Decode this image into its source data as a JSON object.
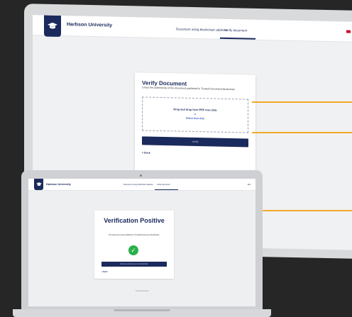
{
  "desktop": {
    "brand": "Harbson University",
    "nav": {
      "blockchain_link": "Document using blockchain address",
      "verify_link": "Verify document"
    },
    "card": {
      "title": "Verify Document",
      "subtitle": "Check the authenticity of the document published in Trusted Document blockchain.",
      "drop_text": "Drag and drop here PDF max 2mb",
      "drop_or": "or",
      "drop_link": "Select from disk",
      "verify_button": "Verify",
      "back_link": "< Back"
    }
  },
  "laptop": {
    "brand": "Harbson University",
    "nav": {
      "blockchain_link": "Document using blockchain address",
      "verify_link": "Verify document"
    },
    "language": "EN",
    "card": {
      "title": "Verification Positive",
      "description": "The document was published in Trusted Document blockchain.",
      "button": "View the document on the blockchain",
      "back_link": "< Back"
    },
    "footer": "Trusted Document"
  },
  "colors": {
    "background": "#262626",
    "brand_navy": "#1b2a5c",
    "success_green": "#28b04a",
    "accent_orange": "#f1a92a"
  },
  "icons": [
    "graduation-cap-icon",
    "check-circle-icon",
    "flag-icon"
  ]
}
